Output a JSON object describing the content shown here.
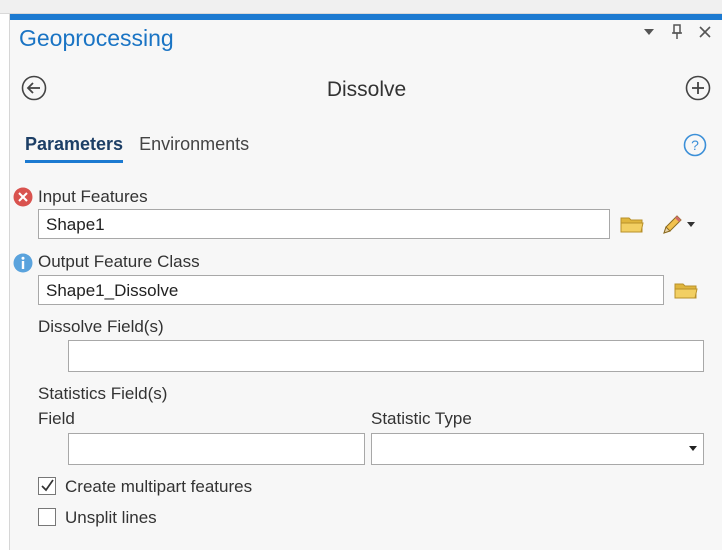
{
  "colors": {
    "accent": "#1c7ad1",
    "title": "#1a74c4",
    "error": "#d9534f",
    "info": "#5aa3dd",
    "folder": "#e0b63d"
  },
  "pane": {
    "title": "Geoprocessing",
    "controls": {
      "menu_icon": "dropdown-arrow-icon",
      "pin_icon": "pin-icon",
      "close_icon": "close-icon"
    }
  },
  "tool": {
    "name": "Dissolve",
    "back_icon": "back-arrow-icon",
    "add_icon": "add-circle-icon"
  },
  "tabs": [
    {
      "label": "Parameters",
      "active": true
    },
    {
      "label": "Environments",
      "active": false
    }
  ],
  "help_icon": "help-icon",
  "params": {
    "input_features": {
      "label": "Input Features",
      "value": "Shape1",
      "status": "error"
    },
    "output_feature_class": {
      "label": "Output Feature Class",
      "value": "Shape1_Dissolve",
      "status": "info"
    },
    "dissolve_fields": {
      "label": "Dissolve Field(s)",
      "value": ""
    },
    "statistics_fields": {
      "label": "Statistics Field(s)",
      "field_label": "Field",
      "field_value": "",
      "statistic_type_label": "Statistic Type",
      "statistic_type_value": ""
    },
    "create_multipart": {
      "label": "Create multipart features",
      "checked": true
    },
    "unsplit_lines": {
      "label": "Unsplit lines",
      "checked": false
    }
  }
}
